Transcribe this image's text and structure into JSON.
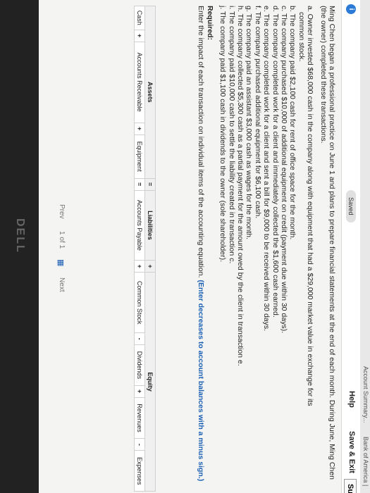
{
  "bookmarks": [
    "Bank of America |",
    "Account Summary..."
  ],
  "header": {
    "saved_label": "Saved",
    "help_label": "Help",
    "save_exit_label": "Save & Exit",
    "submit_label": "Su"
  },
  "question": {
    "intro": "Ming Chen began a professional practice on June 1 and plans to prepare financial statements at the end of each month. During June, Ming Chen (the owner) completed these transactions.",
    "transactions": [
      "a. Owner invested $68,000 cash in the company along with equipment that had a $29,000 market value in exchange for its",
      "   common stock.",
      "b. The company paid $2,100 cash for rent of office space for the month.",
      "c. The company purchased $10,000 of additional equipment on credit (payment due within 30 days).",
      "d. The company completed work for a client and immediately collected the $1,600 cash earned.",
      "e. The company completed work for a client and sent a bill for $9,000 to be received within 30 days.",
      "f. The company purchased additional equipment for $6,100 cash.",
      "g. The company paid an assistant $3,000 cash as wages for the month.",
      "h. The company collected $5,300 cash as a partial payment for the amount owed by the client in transaction e.",
      "i. The company paid $10,000 cash to settle the liability created in transaction c.",
      "j. The company paid $1,100 cash in dividends to the owner (sole shareholder)."
    ],
    "required_label": "Required:",
    "required_text": "Enter the impact of each transaction on individual items of the accounting equation.",
    "required_note": "(Enter decreases to account balances with a minus sign.)"
  },
  "equation": {
    "assets_label": "Assets",
    "equals": "=",
    "liabilities_label": "Liabilities",
    "plus": "+",
    "minus": "-",
    "equity_label": "Equity",
    "columns": [
      "Cash",
      "Accounts Receivable",
      "Equipment",
      "Accounts Payable",
      "Common Stock",
      "Dividends",
      "Revenues",
      "Expenses"
    ]
  },
  "pager": {
    "prev": "Prev",
    "page": "1 of 1",
    "next": "Next"
  },
  "monitor_brand": "DELL"
}
